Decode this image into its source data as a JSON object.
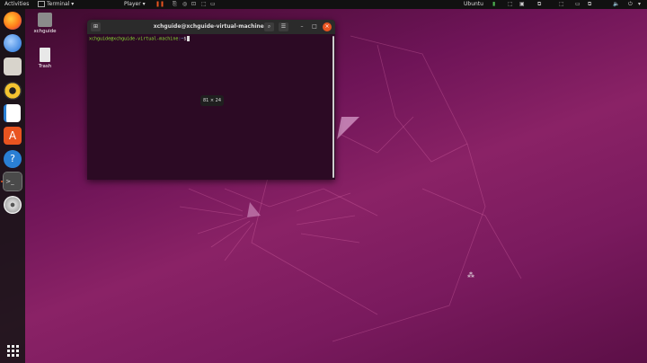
{
  "topbar": {
    "activities": "Activities",
    "app_menu": "Terminal",
    "app_menu_arrow": "▾",
    "player": "Player",
    "player_arrow": "▾",
    "keyboard": "Ubuntu"
  },
  "desktop": {
    "icons": [
      {
        "label": "xchguide",
        "icon": "home-folder-icon"
      },
      {
        "label": "Trash",
        "icon": "trash-icon"
      }
    ]
  },
  "dock": {
    "items": [
      "firefox-icon",
      "thunderbird-icon",
      "files-icon",
      "rhythmbox-icon",
      "writer-icon",
      "software-icon",
      "help-icon",
      "terminal-icon",
      "dvd-icon"
    ],
    "apps_grid": "show-applications-icon"
  },
  "terminal": {
    "title": "xchguide@xchguide-virtual-machine: ~",
    "prompt_user": "xchguide@xchguide-virtual-machine",
    "prompt_path": ":~",
    "prompt_symbol": "$",
    "size_tooltip": "81 × 24"
  },
  "colors": {
    "accent": "#e95420",
    "prompt_green": "#8ae234",
    "prompt_blue": "#729fcf",
    "terminal_bg": "#2c0a24"
  }
}
